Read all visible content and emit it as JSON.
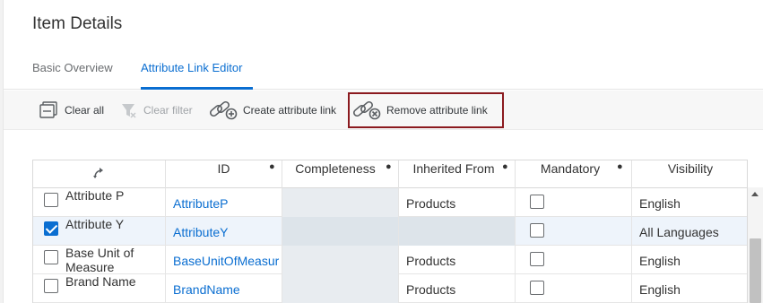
{
  "header": {
    "title": "Item Details",
    "tabs": [
      {
        "label": "Basic Overview",
        "active": false
      },
      {
        "label": "Attribute Link Editor",
        "active": true
      }
    ]
  },
  "toolbar": {
    "clear_all": "Clear all",
    "clear_filter": "Clear filter",
    "create_link": "Create attribute link",
    "remove_link": "Remove attribute link"
  },
  "table": {
    "columns": [
      "ID",
      "Completeness",
      "Inherited From",
      "Mandatory",
      "Visibility"
    ],
    "rows": [
      {
        "name": "Attribute P",
        "id": "AttributeP",
        "completeness": "",
        "inherited_from": "Products",
        "mandatory": false,
        "visibility": "English",
        "selected": false
      },
      {
        "name": "Attribute Y",
        "id": "AttributeY",
        "completeness": "",
        "inherited_from": "",
        "mandatory": false,
        "visibility": "All Languages",
        "selected": true
      },
      {
        "name": "Base Unit of Measure",
        "id": "BaseUnitOfMeasur",
        "completeness": "",
        "inherited_from": "Products",
        "mandatory": false,
        "visibility": "English",
        "selected": false
      },
      {
        "name": "Brand Name",
        "id": "BrandName",
        "completeness": "",
        "inherited_from": "Products",
        "mandatory": false,
        "visibility": "English",
        "selected": false
      }
    ]
  },
  "colors": {
    "accent": "#0a6ed1",
    "highlight_border": "#8b1a1f"
  }
}
